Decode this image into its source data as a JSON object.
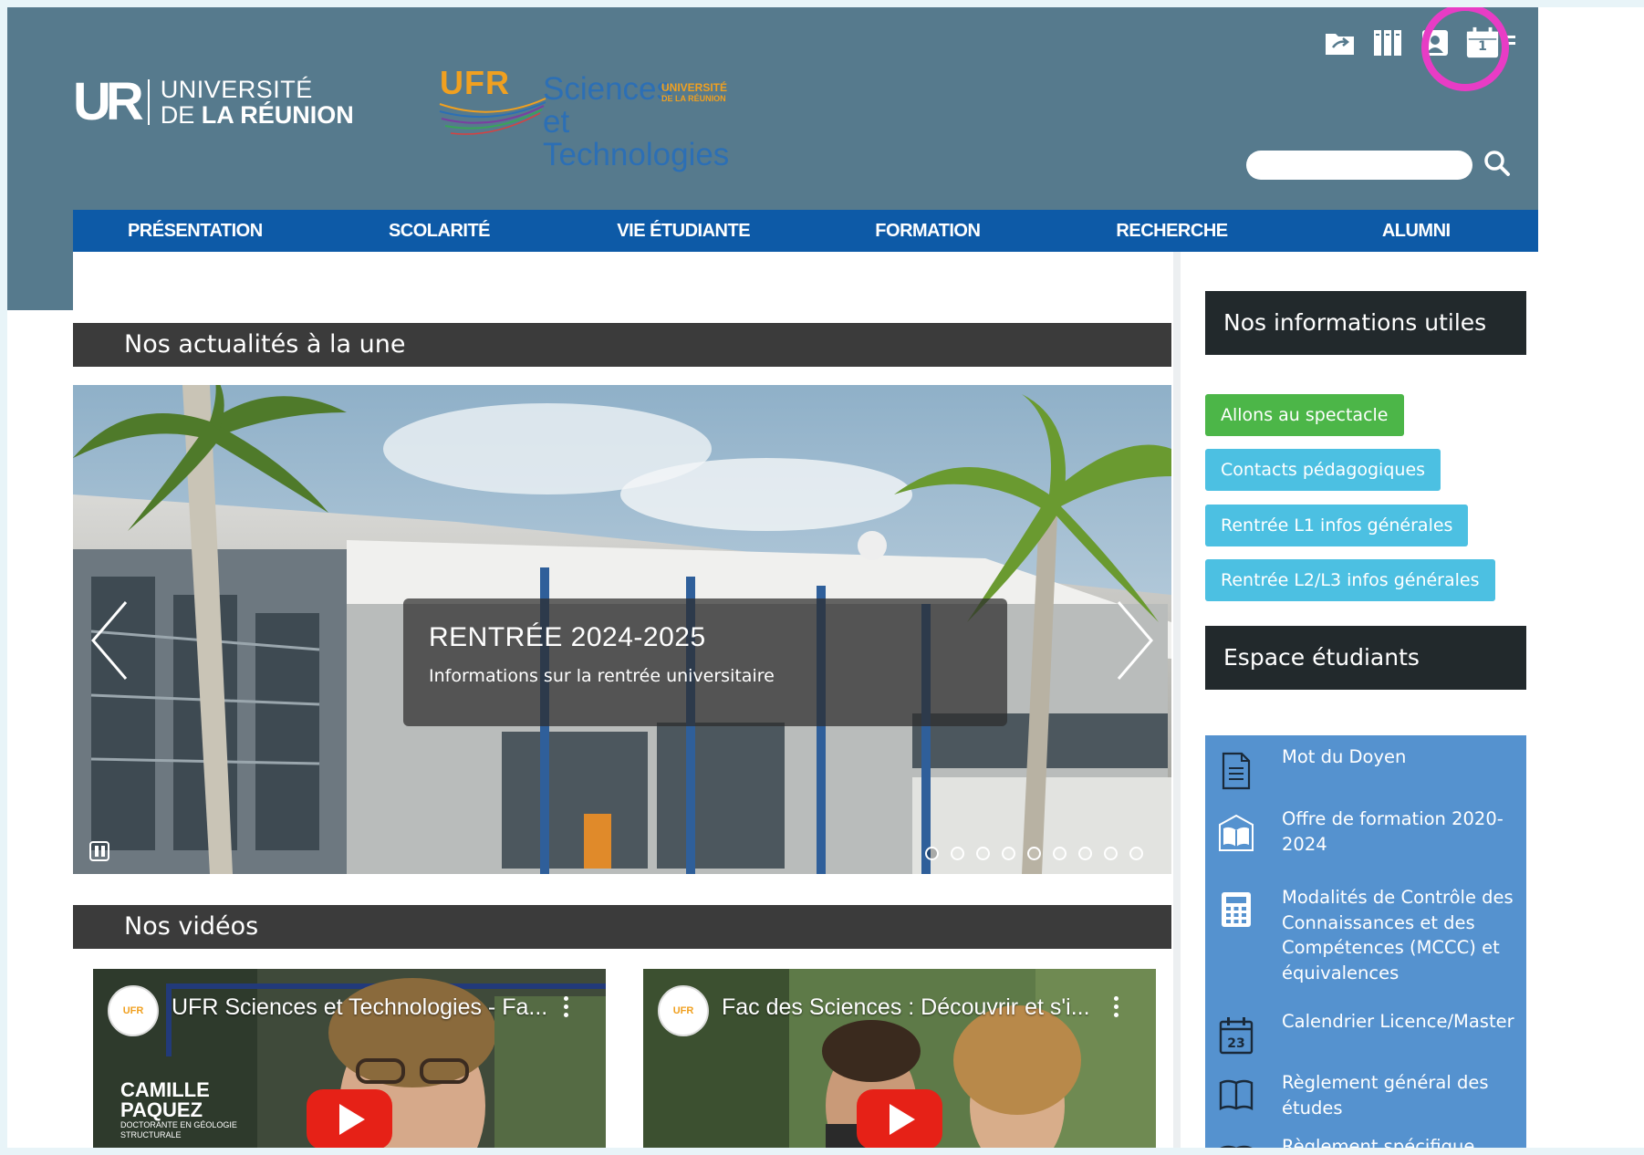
{
  "header": {
    "univ_mark": "UR",
    "univ_line1": "UNIVERSITÉ",
    "univ_line2_prefix": "DE ",
    "univ_line2_bold": "LA RÉUNION",
    "ufr_label": "UFR",
    "ufr_line1": "Sciences",
    "ufr_line2": "et Technologies",
    "ufr_univ": "UNIVERSITÉ",
    "ufr_univ_small": "DE LA RÉUNION",
    "top_icons": [
      "folder-share-icon",
      "library-icon",
      "user-icon",
      "calendar-icon"
    ],
    "calendar_day": "1",
    "search": {
      "placeholder": "",
      "value": ""
    }
  },
  "nav": {
    "items": [
      {
        "label": "PRÉSENTATION"
      },
      {
        "label": "SCOLARITÉ"
      },
      {
        "label": "VIE ÉTUDIANTE"
      },
      {
        "label": "FORMATION"
      },
      {
        "label": "RECHERCHE"
      },
      {
        "label": "ALUMNI"
      }
    ]
  },
  "main": {
    "news_title": "Nos actualités à la une",
    "slide": {
      "title": "RENTRÉE 2024-2025",
      "subtitle": "Informations sur la rentrée universitaire",
      "dot_count": 9,
      "active_dot": 1
    },
    "videos_title": "Nos vidéos",
    "videos": [
      {
        "title": "UFR Sciences et Technologies - Fa...",
        "overlay_line1": "CAMILLE",
        "overlay_line2": "PAQUEZ",
        "overlay_line3": "DOCTORANTE EN GÉOLOGIE",
        "overlay_line4": "STRUCTURALE"
      },
      {
        "title": "Fac des Sciences : Découvrir et s'i..."
      }
    ]
  },
  "sidebar": {
    "useful_title": "Nos informations utiles",
    "buttons": [
      {
        "label": "Allons au spectacle",
        "color": "#4cb648"
      },
      {
        "label": "Contacts pédagogiques",
        "color": "#4cc0e2"
      },
      {
        "label": "Rentrée L1 infos générales",
        "color": "#4cc0e2"
      },
      {
        "label": "Rentrée L2/L3 infos générales",
        "color": "#4cc0e2"
      }
    ],
    "student_title": "Espace étudiants",
    "student_items": [
      {
        "label": "Mot du Doyen",
        "icon": "document-icon"
      },
      {
        "label": "Offre de formation 2020-2024",
        "icon": "open-book-icon"
      },
      {
        "label": "Modalités de Contrôle des Connaissances et des Compétences (MCCC) et équivalences",
        "icon": "calculator-icon"
      },
      {
        "label": "Calendrier Licence/Master",
        "icon": "calendar-icon",
        "day": "23"
      },
      {
        "label": "Règlement général des études",
        "icon": "book-icon"
      },
      {
        "label": "Règlement spécifique",
        "icon": "book-icon"
      }
    ]
  },
  "colors": {
    "header_band": "#567a8d",
    "nav": "#0d5aa7",
    "section_bar": "#3b3b3b",
    "sidebar_head": "#22292c",
    "student_box": "#5592cf",
    "annotation": "#e83cc5"
  }
}
